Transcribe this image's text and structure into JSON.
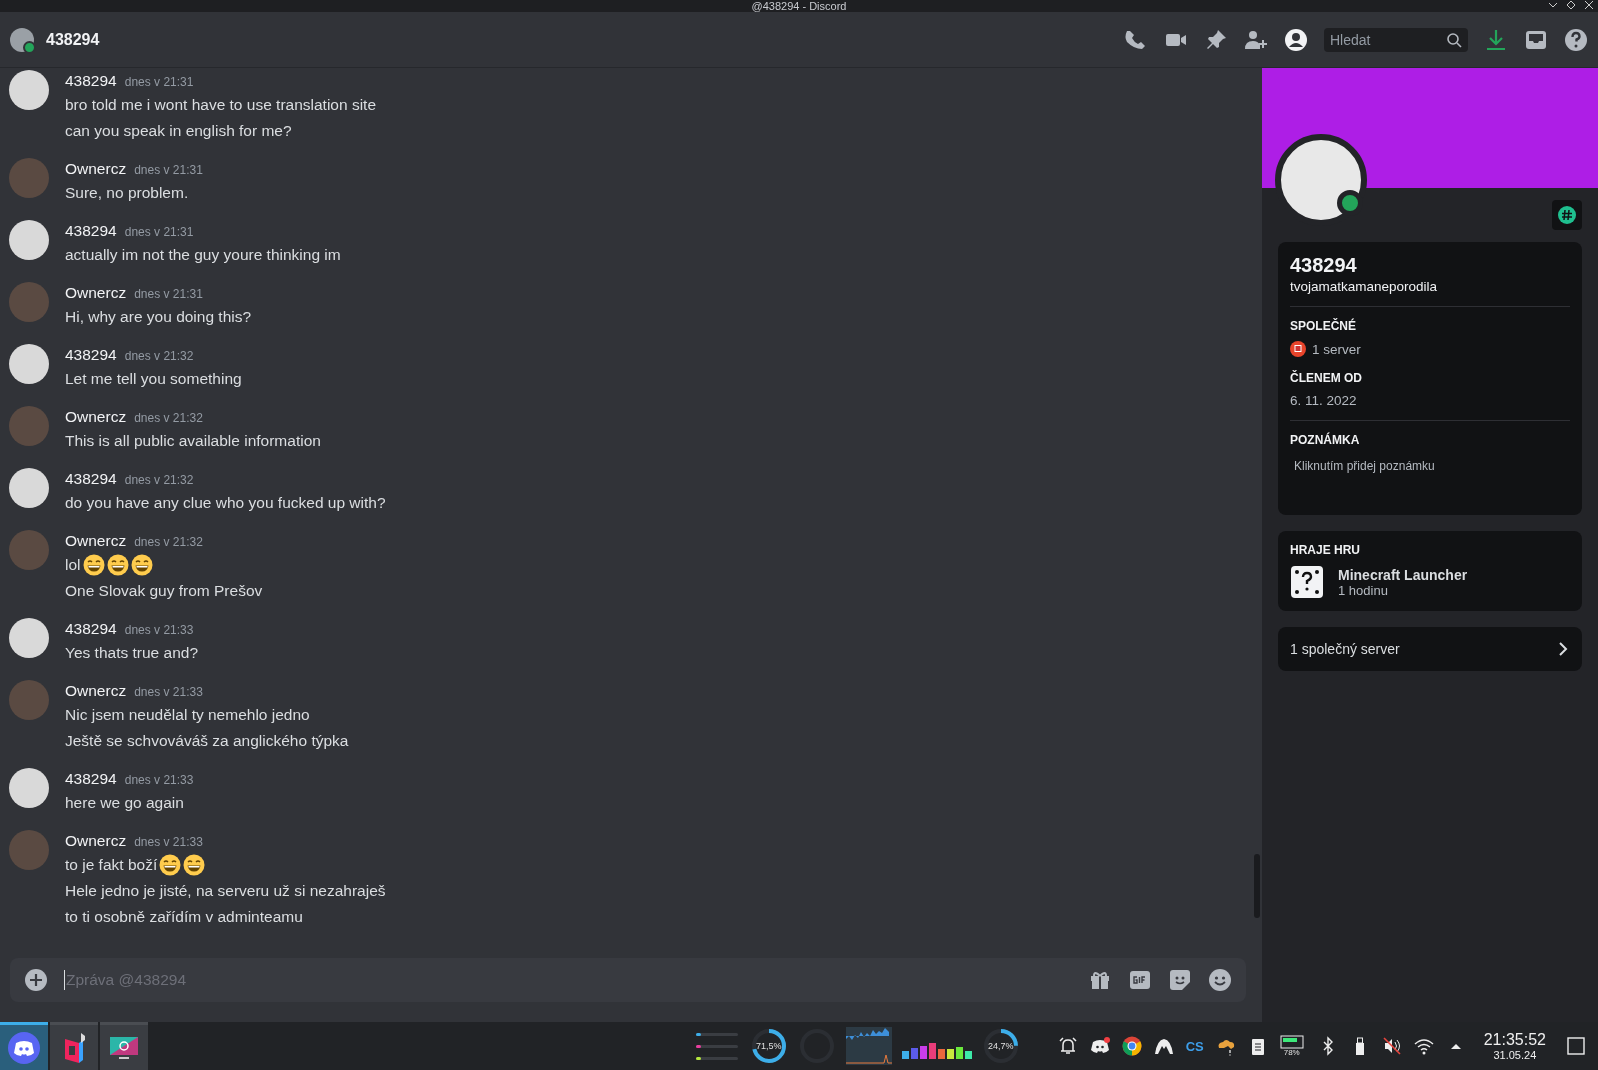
{
  "window": {
    "title": "@438294 - Discord"
  },
  "header": {
    "user": "438294",
    "online": true,
    "search": {
      "placeholder": "Hledat"
    },
    "profile_panel_open": true
  },
  "messages": [
    {
      "author": "438294",
      "time": "dnes v 21:31",
      "lines": [
        {
          "text": "bro told me i wont have to use translation site"
        },
        {
          "text": "can you speak in english for me?"
        }
      ]
    },
    {
      "author": "Ownercz",
      "time": "dnes v 21:31",
      "lines": [
        {
          "text": "Sure,  no problem."
        }
      ]
    },
    {
      "author": "438294",
      "time": "dnes v 21:31",
      "lines": [
        {
          "text": "actually im not the guy youre thinking im"
        }
      ]
    },
    {
      "author": "Ownercz",
      "time": "dnes v 21:31",
      "lines": [
        {
          "text": "Hi, why are you doing this?"
        }
      ]
    },
    {
      "author": "438294",
      "time": "dnes v 21:32",
      "lines": [
        {
          "text": "Let me tell you something"
        }
      ]
    },
    {
      "author": "Ownercz",
      "time": "dnes v 21:32",
      "lines": [
        {
          "text": "This is all public available information"
        }
      ]
    },
    {
      "author": "438294",
      "time": "dnes v 21:32",
      "lines": [
        {
          "text": "do you have any clue who you fucked up with?"
        }
      ]
    },
    {
      "author": "Ownercz",
      "time": "dnes v 21:32",
      "lines": [
        {
          "parts": [
            {
              "kind": "text",
              "text": "lol"
            },
            {
              "kind": "grin_emoji"
            },
            {
              "kind": "grin_emoji"
            },
            {
              "kind": "grin_emoji"
            }
          ]
        },
        {
          "text": "One Slovak guy from Prešov"
        }
      ]
    },
    {
      "author": "438294",
      "time": "dnes v 21:33",
      "lines": [
        {
          "text": "Yes thats true and?"
        }
      ]
    },
    {
      "author": "Ownercz",
      "time": "dnes v 21:33",
      "lines": [
        {
          "text": "Nic jsem neudělal ty nemehlo jedno"
        },
        {
          "text": "Ještě se schvováváš za anglického týpka"
        }
      ]
    },
    {
      "author": "438294",
      "time": "dnes v 21:33",
      "lines": [
        {
          "text": "here we go again"
        }
      ]
    },
    {
      "author": "Ownercz",
      "time": "dnes v 21:33",
      "lines": [
        {
          "parts": [
            {
              "kind": "text",
              "text": "to je fakt boží"
            },
            {
              "kind": "grin_emoji"
            },
            {
              "kind": "grin_emoji"
            }
          ]
        },
        {
          "text": "Hele jedno je jisté, na serveru už si nezahraješ"
        },
        {
          "text": "to ti osobně zařídím v adminteamu"
        }
      ]
    }
  ],
  "composer": {
    "placeholder": "Zpráva @438294"
  },
  "profile": {
    "display_name": "438294",
    "username": "tvojamatkamaneporodila",
    "online": true,
    "mutual_label": "SPOLEČNÉ",
    "mutual_value": "1 server",
    "member_since_label": "ČLENEM OD",
    "member_since": "6. 11. 2022",
    "note_label": "POZNÁMKA",
    "note_placeholder": "Kliknutím přidej poznámku",
    "activity": {
      "label": "HRAJE HRU",
      "game": "Minecraft Launcher",
      "duration": "1 hodinu"
    },
    "mutual_servers": "1 společný server"
  },
  "taskbar": {
    "apps": [
      {
        "kind": "discord",
        "selected": true
      },
      {
        "kind": "cube",
        "selected": false
      },
      {
        "kind": "screenshot",
        "selected": false
      }
    ],
    "cpu": {
      "level": 0.715,
      "reading": "71,5%"
    },
    "gauge": {
      "level": 0.247,
      "reading": "24,7%"
    },
    "cs_label": "CS",
    "battery": "78%",
    "sound_muted": true,
    "time": "21:35:52",
    "date": "31.05.24"
  }
}
